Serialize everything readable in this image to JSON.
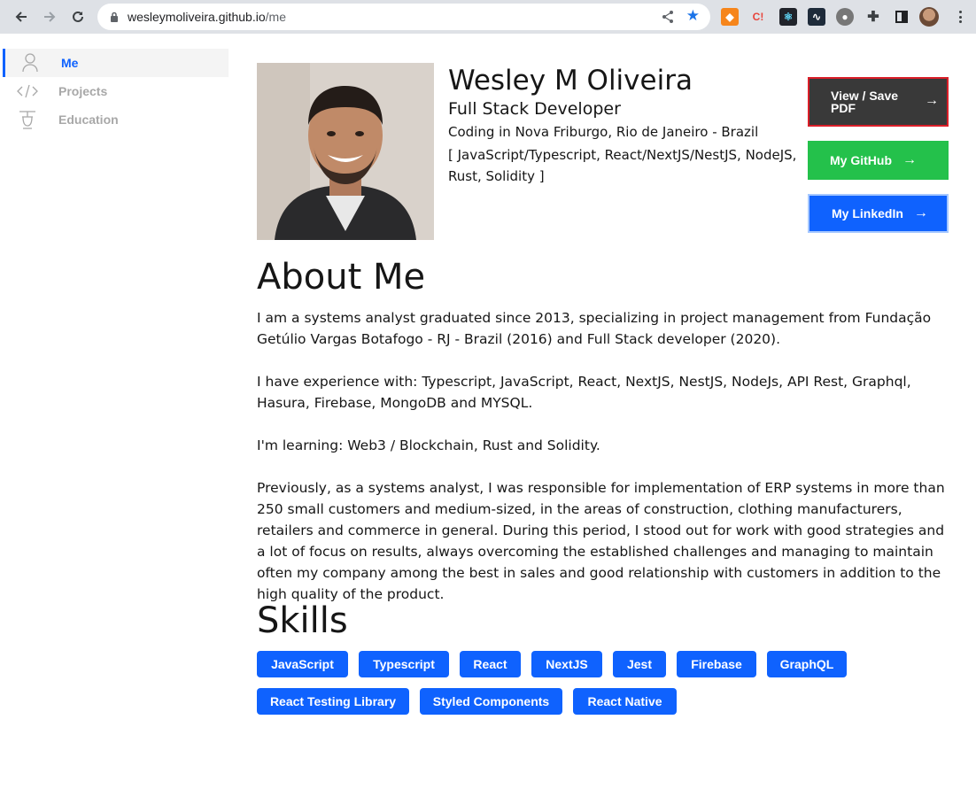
{
  "browser": {
    "url_host": "wesleymoliveira.github.io",
    "url_path": "/me"
  },
  "sidebar": {
    "items": [
      {
        "label": "Me",
        "icon": "user-icon",
        "active": true
      },
      {
        "label": "Projects",
        "icon": "code-icon",
        "active": false
      },
      {
        "label": "Education",
        "icon": "education-icon",
        "active": false
      }
    ]
  },
  "profile": {
    "name": "Wesley M Oliveira",
    "role": "Full Stack Developer",
    "location": "Coding in Nova Friburgo, Rio de Janeiro - Brazil",
    "stack": "[ JavaScript/Typescript, React/NextJS/NestJS, NodeJS, Rust, Solidity ]"
  },
  "actions": {
    "pdf": "View / Save PDF",
    "github": "My GitHub",
    "linkedin": "My LinkedIn"
  },
  "about": {
    "heading": "About Me",
    "paragraphs": [
      "I am a systems analyst graduated since 2013, specializing in project management from Fundação Getúlio Vargas Botafogo - RJ - Brazil (2016) and Full Stack developer (2020).",
      "I have experience with: Typescript, JavaScript, React, NextJS, NestJS, NodeJs, API Rest, Graphql, Hasura, Firebase, MongoDB and MYSQL.",
      "I'm learning: Web3 / Blockchain, Rust and Solidity.",
      "Previously, as a systems analyst, I was responsible for implementation of ERP systems in more than 250 small customers and medium-sized, in the areas of construction, clothing manufacturers, retailers and commerce in general. During this period, I stood out for work with good strategies and a lot of focus on results, always overcoming the established challenges and managing to maintain often my company among the best in sales and good relationship with customers in addition to the high quality of the product."
    ]
  },
  "skills": {
    "heading": "Skills",
    "items": [
      "JavaScript",
      "Typescript",
      "React",
      "NextJS",
      "Jest",
      "Firebase",
      "GraphQL",
      "React Testing Library",
      "Styled Components",
      "React Native"
    ]
  },
  "colors": {
    "primary": "#0f62fe",
    "github": "#24c14b",
    "pdf_bg": "#393939",
    "pdf_border": "#da1e28"
  }
}
